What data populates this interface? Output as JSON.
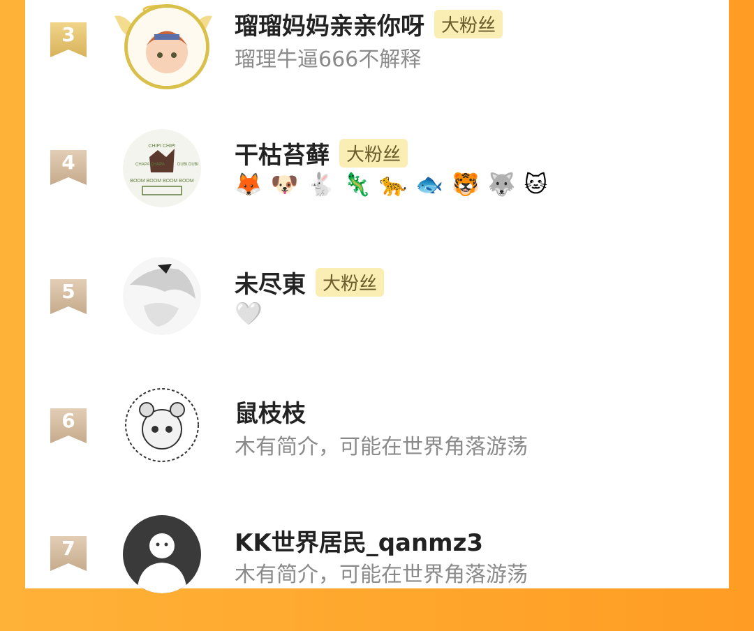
{
  "rows": [
    {
      "rank": "3",
      "name": "瑠瑠妈妈亲亲你呀",
      "badge": "大粉丝",
      "bio": "瑠理牛逼666不解释"
    },
    {
      "rank": "4",
      "name": "干枯苔藓",
      "badge": "大粉丝",
      "emojis": [
        "🦊",
        "🐶",
        "🐇",
        "🦎",
        "🐆",
        "🐟",
        "🐯",
        "🐺",
        "🐱"
      ]
    },
    {
      "rank": "5",
      "name": "未尽東",
      "badge": "大粉丝",
      "emojis": [
        "🤍"
      ]
    },
    {
      "rank": "6",
      "name": "鼠枝枝",
      "bio": "木有简介，可能在世界角落游荡"
    },
    {
      "rank": "7",
      "name": "KK世界居民_qanmz3",
      "bio": "木有简介，可能在世界角落游荡"
    }
  ],
  "avatar4_lines": [
    "CHIPI CHIPI",
    "CHAPA CHAPA",
    "DUBI DUBI",
    "BOOM BOOM BOOM BOOM"
  ]
}
